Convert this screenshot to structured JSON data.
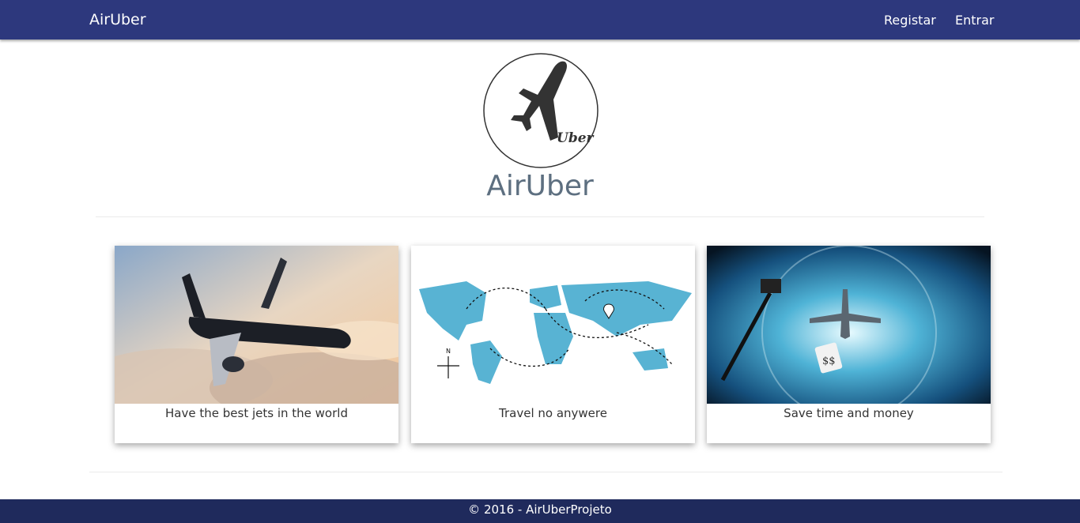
{
  "navbar": {
    "brand": "AirUber",
    "links": [
      {
        "label": "Registar"
      },
      {
        "label": "Entrar"
      }
    ]
  },
  "logo": {
    "text": "Uber",
    "icon": "airplane-icon"
  },
  "site_title": "AirUber",
  "cards": [
    {
      "caption": "Have the best jets in the world",
      "image": "black-jet-in-clouds"
    },
    {
      "caption": "Travel no anywere",
      "image": "world-map-flight-routes"
    },
    {
      "caption": "Save time and money",
      "image": "airplane-over-clock-sky"
    }
  ],
  "footer": {
    "text": "© 2016 - AirUberProjeto"
  },
  "colors": {
    "navbar": "#2d387d",
    "footer": "#1f2a5c",
    "title": "#5d6f80"
  }
}
